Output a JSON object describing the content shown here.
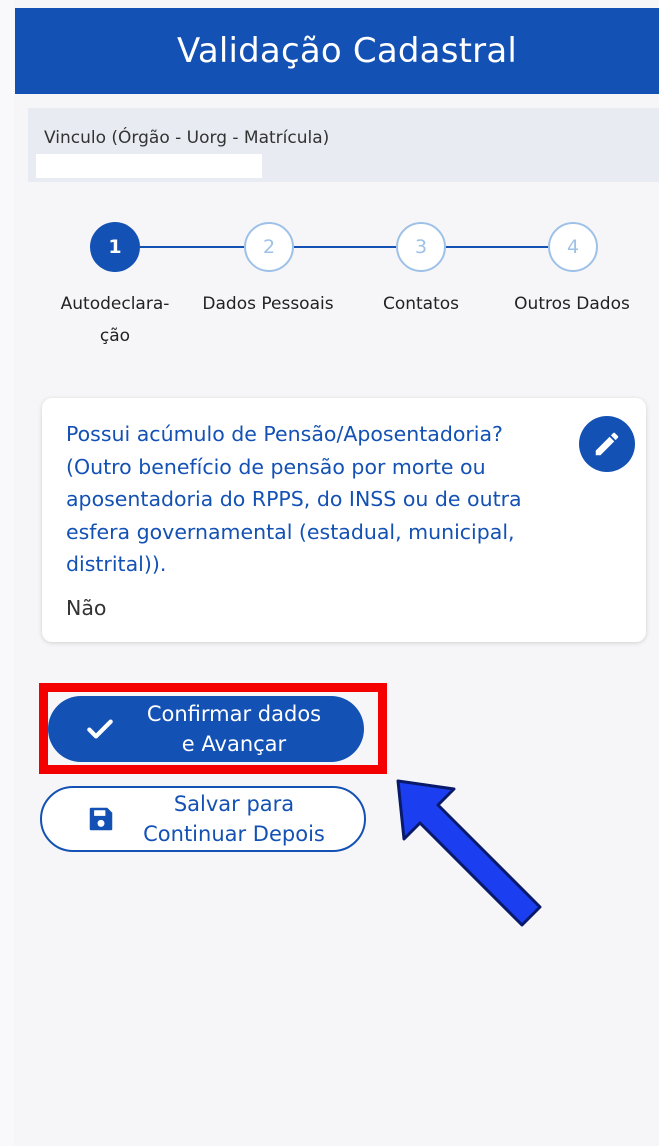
{
  "header": {
    "title": "Validação Cadastral"
  },
  "vinculo": {
    "label": "Vinculo (Órgão - Uorg - Matrícula)",
    "value": ""
  },
  "stepper": {
    "steps": [
      {
        "number": "1",
        "label_line1": "Autodeclara-",
        "label_line2": "ção",
        "status": "active"
      },
      {
        "number": "2",
        "label_line1": "Dados Pessoais",
        "label_line2": "",
        "status": "inactive"
      },
      {
        "number": "3",
        "label_line1": "Contatos",
        "label_line2": "",
        "status": "inactive"
      },
      {
        "number": "4",
        "label_line1": "Outros Dados",
        "label_line2": "",
        "status": "inactive"
      }
    ]
  },
  "card": {
    "question_lines": [
      "Possui acúmulo de Pensão/Aposentadoria?",
      "(Outro benefício de pensão por morte ou",
      "aposentadoria do RPPS, do INSS ou de outra",
      "esfera governamental (estadual, municipal,",
      "distrital))."
    ],
    "answer": "Não",
    "edit_icon": "pencil-icon"
  },
  "actions": {
    "confirm_line1": "Confirmar dados",
    "confirm_line2": "e Avançar",
    "confirm_icon": "check-icon",
    "save_line1": "Salvar para",
    "save_line2": "Continuar Depois",
    "save_icon": "floppy-disk-icon"
  },
  "colors": {
    "primary": "#1351b4",
    "highlight": "#f50000",
    "arrow": "#1a3ef0"
  }
}
